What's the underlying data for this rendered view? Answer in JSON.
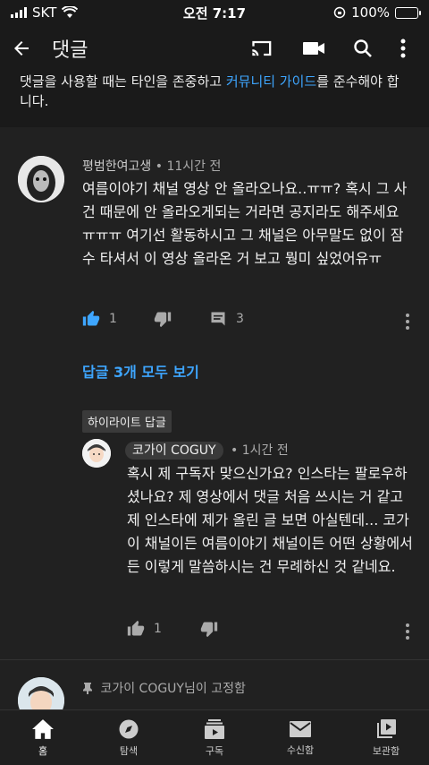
{
  "status": {
    "carrier": "SKT",
    "time": "오전 7:17",
    "battery": "100%"
  },
  "appbar": {
    "title": "댓글"
  },
  "guide": {
    "pre": "댓글을 사용할 때는 타인을 존중하고 ",
    "link": "커뮤니티 가이드",
    "post": "를 준수해야 합니다."
  },
  "comment1": {
    "author": "평범한여고생",
    "time": "• 11시간 전",
    "text": "여름이야기 채널 영상 안 올라오나요..ㅠㅠ? 혹시 그 사건 때문에 안 올라오게되는 거라면 공지라도 해주세요 ㅠㅠㅠ 여기선 활동하시고 그 채널은 아무말도 없이 잠수 타셔서 이 영상 올라온 거 보고 뭥미 싶었어유ㅠ",
    "likes": "1",
    "replies": "3"
  },
  "view_replies": "답글 3개 모두 보기",
  "highlight_label": "하이라이트 답글",
  "reply1": {
    "author": "코가이 COGUY",
    "time": "• 1시간 전",
    "text": "혹시 제 구독자 맞으신가요? 인스타는 팔로우하셨나요? 제 영상에서 댓글 처음 쓰시는 거 같고 제 인스타에 제가 올린 글 보면 아실텐데... 코가이 채널이든 여름이야기 채널이든 어떤 상황에서든 이렇게 말씀하시는 건 무례하신 것 같네요.",
    "likes": "1"
  },
  "pinned": {
    "text": "코가이 COGUY님이 고정함"
  },
  "nav": [
    {
      "label": "홈",
      "icon": "home-icon"
    },
    {
      "label": "탐색",
      "icon": "compass-icon"
    },
    {
      "label": "구독",
      "icon": "subscriptions-icon"
    },
    {
      "label": "수신함",
      "icon": "mail-icon"
    },
    {
      "label": "보관함",
      "icon": "library-icon"
    }
  ]
}
